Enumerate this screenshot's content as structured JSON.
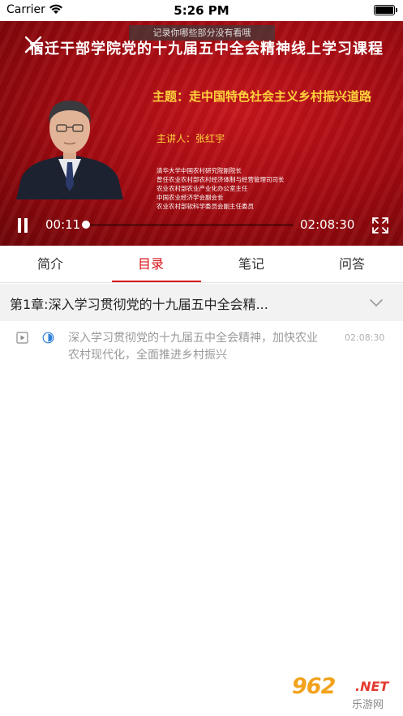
{
  "status_bar": {
    "carrier": "Carrier",
    "time": "5:26 PM",
    "battery_level": 1.0
  },
  "video": {
    "course_title": "宿迁干部学院党的十九届五中全会精神线上学习课程",
    "tooltip": "记录你哪些部分没有看哦",
    "subject": "主题：走中国特色社会主义乡村振兴道路",
    "speaker": "主讲人：张红宇",
    "bio": [
      "清华大学中国农村研究院副院长",
      "曾任农业农村部农村经济体制与经营管理司司长",
      "农业农村部农业产业化办公室主任",
      "中国农业经济学会副会长",
      "农业农村部软科学委员会副主任委员"
    ],
    "current_time": "00:11",
    "total_time": "02:08:30",
    "progress_fraction": 0.001
  },
  "tabs": [
    {
      "label": "简介",
      "active": false
    },
    {
      "label": "目录",
      "active": true
    },
    {
      "label": "笔记",
      "active": false
    },
    {
      "label": "问答",
      "active": false
    }
  ],
  "chapter": {
    "title": "第1章:深入学习贯彻党的十九届五中全会精..."
  },
  "lesson": {
    "title": "深入学习贯彻党的十九届五中全会精神，加快农业农村现代化，全面推进乡村振兴",
    "duration": "02:08:30"
  },
  "watermark": {
    "brand_number": "962",
    "brand_suffix": ".NET",
    "brand_cn": "乐游网"
  },
  "colors": {
    "accent": "#d7141a",
    "video_bg": "#b00f16",
    "subject_text": "#ffd23c"
  }
}
